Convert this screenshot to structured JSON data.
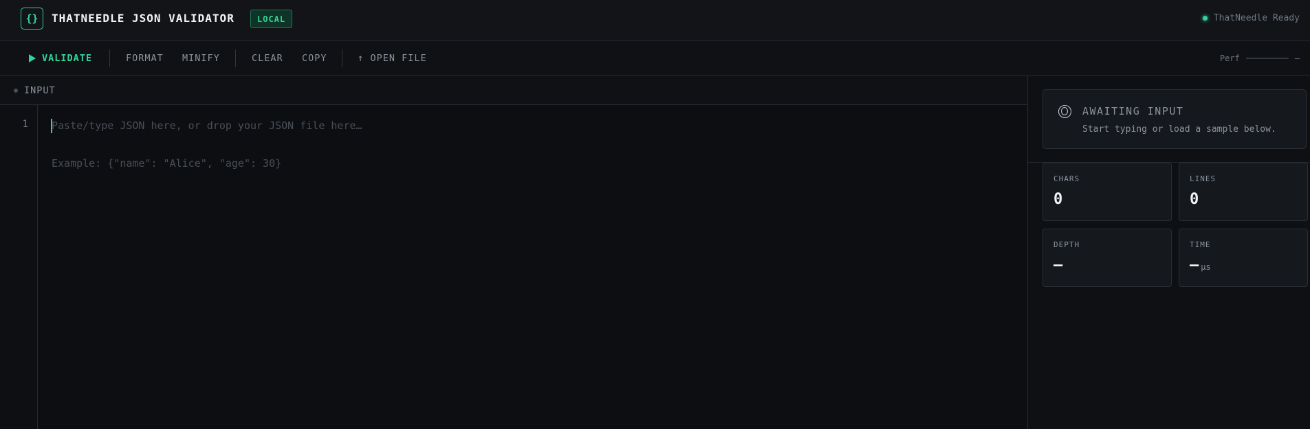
{
  "header": {
    "logo": "{}",
    "title": "THATNEEDLE JSON VALIDATOR",
    "badge": "LOCAL",
    "status": "ThatNeedle Ready",
    "status_color": "#34d399"
  },
  "toolbar": {
    "validate": "VALIDATE",
    "format": "FORMAT",
    "minify": "MINIFY",
    "clear": "CLEAR",
    "copy": "COPY",
    "open_file": "OPEN FILE",
    "open_file_icon": "↑",
    "perf_label": "Perf",
    "perf_value": "—"
  },
  "input": {
    "title": "INPUT",
    "line_number": "1",
    "placeholder": "Paste/type JSON here, or drop your JSON file here…",
    "example": "Example: {\"name\": \"Alice\", \"age\": 30}"
  },
  "result": {
    "title": "AWAITING INPUT",
    "subtitle": "Start typing or load a sample below."
  },
  "stats": {
    "chars": {
      "label": "CHARS",
      "value": "0"
    },
    "lines": {
      "label": "LINES",
      "value": "0"
    },
    "depth": {
      "label": "DEPTH",
      "value": "—"
    },
    "time": {
      "label": "TIME",
      "value": "—",
      "unit": "μs"
    }
  },
  "colors": {
    "accent": "#34d399",
    "background": "#0e0f12"
  }
}
